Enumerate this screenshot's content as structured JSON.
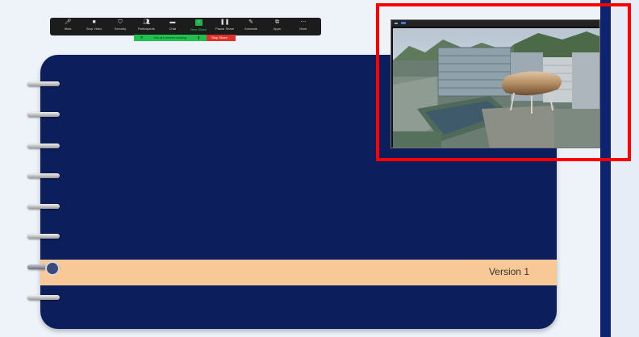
{
  "toolbar": {
    "items": [
      {
        "label": "Mute",
        "icon": "microphone-icon"
      },
      {
        "label": "Stop Video",
        "icon": "video-camera-icon"
      },
      {
        "label": "Security",
        "icon": "shield-icon"
      },
      {
        "label": "Participants",
        "icon": "participants-icon"
      },
      {
        "label": "Chat",
        "icon": "chat-icon"
      },
      {
        "label": "New Share",
        "icon": "share-screen-icon"
      },
      {
        "label": "Pause Share",
        "icon": "pause-icon"
      },
      {
        "label": "Annotate",
        "icon": "pen-icon"
      },
      {
        "label": "Apps",
        "icon": "apps-icon"
      },
      {
        "label": "More",
        "icon": "more-icon"
      }
    ]
  },
  "share_status": {
    "message": "You are screen sharing",
    "stop_label": "Stop Share"
  },
  "slide": {
    "version_label": "Version 1"
  },
  "colors": {
    "notebook": "#0c1f5c",
    "band": "#f8c896",
    "highlight": "#ff0000",
    "share_green": "#22b34a",
    "stop_red": "#e0302a"
  }
}
